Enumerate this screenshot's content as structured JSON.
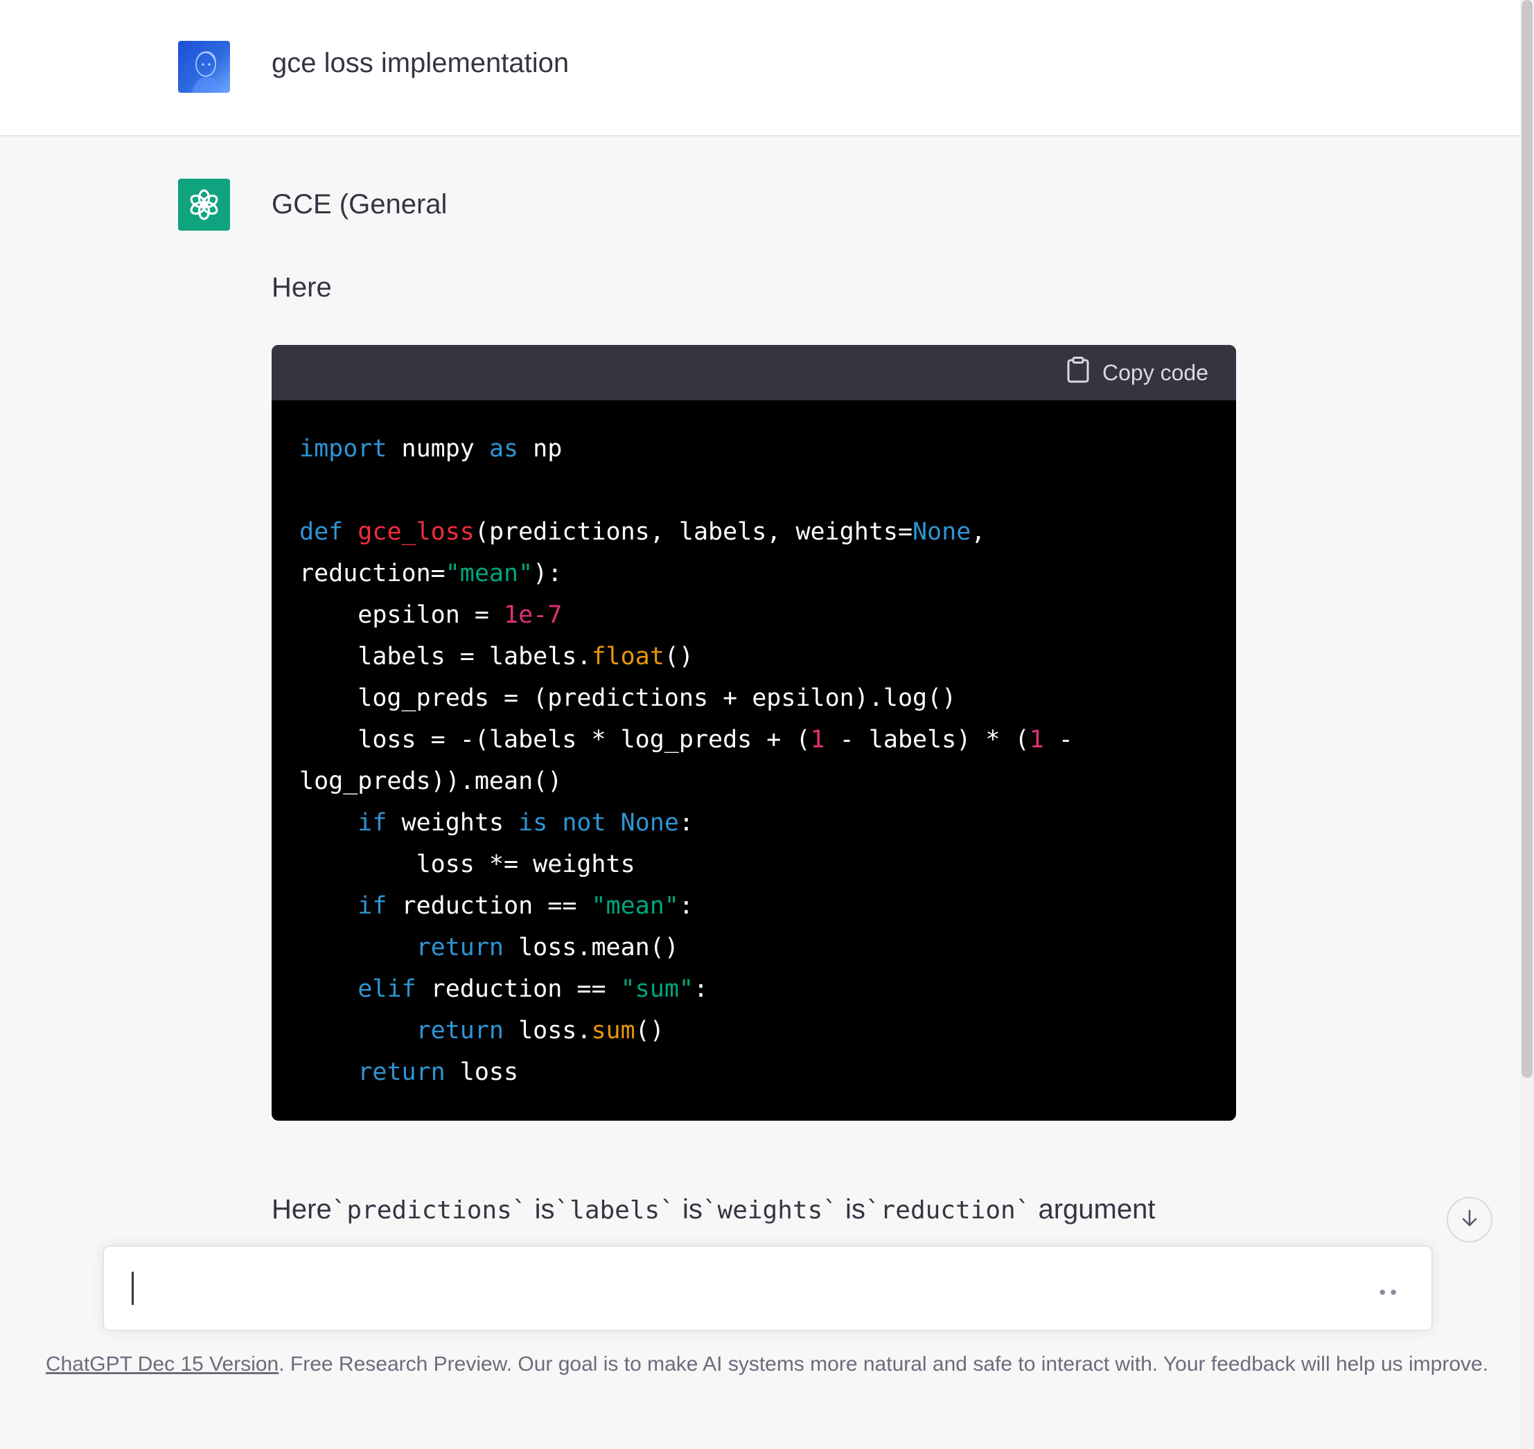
{
  "user_message": "gce loss implementation",
  "bot": {
    "title": "GCE (General",
    "intro": "Here",
    "copy_label": "Copy code",
    "code_lines": [
      [
        {
          "t": "kw",
          "v": "import"
        },
        {
          "t": "",
          "v": " numpy "
        },
        {
          "t": "kw",
          "v": "as"
        },
        {
          "t": "",
          "v": " np"
        }
      ],
      [],
      [
        {
          "t": "kw",
          "v": "def"
        },
        {
          "t": "",
          "v": " "
        },
        {
          "t": "fn",
          "v": "gce_loss"
        },
        {
          "t": "",
          "v": "(predictions, labels, weights="
        },
        {
          "t": "kw",
          "v": "None"
        },
        {
          "t": "",
          "v": ","
        }
      ],
      [
        {
          "t": "",
          "v": "reduction="
        },
        {
          "t": "str",
          "v": "\"mean\""
        },
        {
          "t": "",
          "v": "):"
        }
      ],
      [
        {
          "t": "",
          "v": "    epsilon = "
        },
        {
          "t": "num",
          "v": "1e-7"
        }
      ],
      [
        {
          "t": "",
          "v": "    labels = labels."
        },
        {
          "t": "meth",
          "v": "float"
        },
        {
          "t": "",
          "v": "()"
        }
      ],
      [
        {
          "t": "",
          "v": "    log_preds = (predictions + epsilon).log()"
        }
      ],
      [
        {
          "t": "",
          "v": "    loss = -(labels * log_preds + ("
        },
        {
          "t": "num",
          "v": "1"
        },
        {
          "t": "",
          "v": " - labels) * ("
        },
        {
          "t": "num",
          "v": "1"
        },
        {
          "t": "",
          "v": " -"
        }
      ],
      [
        {
          "t": "",
          "v": "log_preds)).mean()"
        }
      ],
      [
        {
          "t": "",
          "v": "    "
        },
        {
          "t": "kw",
          "v": "if"
        },
        {
          "t": "",
          "v": " weights "
        },
        {
          "t": "kw",
          "v": "is"
        },
        {
          "t": "",
          "v": " "
        },
        {
          "t": "kw",
          "v": "not"
        },
        {
          "t": "",
          "v": " "
        },
        {
          "t": "kw",
          "v": "None"
        },
        {
          "t": "",
          "v": ":"
        }
      ],
      [
        {
          "t": "",
          "v": "        loss *= weights"
        }
      ],
      [
        {
          "t": "",
          "v": "    "
        },
        {
          "t": "kw",
          "v": "if"
        },
        {
          "t": "",
          "v": " reduction == "
        },
        {
          "t": "str",
          "v": "\"mean\""
        },
        {
          "t": "",
          "v": ":"
        }
      ],
      [
        {
          "t": "",
          "v": "        "
        },
        {
          "t": "kw",
          "v": "return"
        },
        {
          "t": "",
          "v": " loss.mean()"
        }
      ],
      [
        {
          "t": "",
          "v": "    "
        },
        {
          "t": "kw",
          "v": "elif"
        },
        {
          "t": "",
          "v": " reduction == "
        },
        {
          "t": "str",
          "v": "\"sum\""
        },
        {
          "t": "",
          "v": ":"
        }
      ],
      [
        {
          "t": "",
          "v": "        "
        },
        {
          "t": "kw",
          "v": "return"
        },
        {
          "t": "",
          "v": " loss."
        },
        {
          "t": "meth",
          "v": "sum"
        },
        {
          "t": "",
          "v": "()"
        }
      ],
      [
        {
          "t": "",
          "v": "    "
        },
        {
          "t": "kw",
          "v": "return"
        },
        {
          "t": "",
          "v": " loss"
        }
      ]
    ],
    "followup": {
      "w1": "Here",
      "c1": "`predictions`",
      "w2": " is",
      "c2": "`labels`",
      "w3": " is",
      "c3": "`weights`",
      "w4": " is",
      "c4": "`reduction`",
      "w5": " argument"
    }
  },
  "input": {
    "placeholder": "",
    "more_label": "••"
  },
  "footer": {
    "link": "ChatGPT Dec 15 Version",
    "text": ". Free Research Preview. Our goal is to make AI systems more natural and safe to interact with. Your feedback will help us improve."
  },
  "icons": {
    "user_avatar": "user-avatar",
    "bot_avatar": "openai-logo-icon",
    "copy": "clipboard-icon",
    "scroll": "arrow-down-icon"
  },
  "colors": {
    "keyword": "#2e95d3",
    "function": "#f22c3d",
    "string": "#00a67d",
    "number": "#df3079",
    "method": "#e9950c",
    "brand": "#10a37f"
  }
}
